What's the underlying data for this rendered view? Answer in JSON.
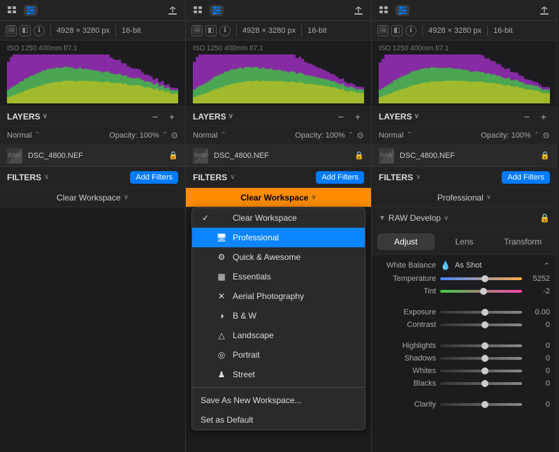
{
  "panels": [
    {
      "id": "panel1",
      "toolbar": {
        "icons": [
          "grid",
          "sliders",
          "upload"
        ]
      },
      "histogram": {
        "meta": "ISO 1250   400mm   f/7.1",
        "resolution": "4928 × 3280 px",
        "bitdepth": "16-bit"
      },
      "layers": {
        "title": "LAYERS",
        "opacity": "Opacity: 100%",
        "blend": "Normal",
        "items": [
          {
            "name": "DSC_4800.NEF"
          }
        ]
      },
      "filters": {
        "title": "FILTERS",
        "add_label": "Add Filters"
      },
      "workspace": {
        "label": "Clear Workspace",
        "active": false
      }
    },
    {
      "id": "panel2",
      "toolbar": {
        "icons": [
          "grid",
          "sliders",
          "upload"
        ]
      },
      "histogram": {
        "meta": "ISO 1250   400mm   f/7.1",
        "resolution": "4928 × 3280 px",
        "bitdepth": "16-bit"
      },
      "layers": {
        "title": "LAYERS",
        "opacity": "Opacity: 100%",
        "blend": "Normal",
        "items": [
          {
            "name": "DSC_4800.NEF"
          }
        ]
      },
      "filters": {
        "title": "FILTERS",
        "add_label": "Add Filters"
      },
      "workspace": {
        "label": "Clear Workspace",
        "active": true
      },
      "dropdown": {
        "items": [
          {
            "type": "check",
            "check": "✓",
            "icon": "",
            "label": "Clear Workspace",
            "selected": false
          },
          {
            "type": "item",
            "check": "",
            "icon": "🖥",
            "label": "Professional",
            "selected": true
          },
          {
            "type": "item",
            "check": "",
            "icon": "⚙",
            "label": "Quick & Awesome",
            "selected": false
          },
          {
            "type": "item",
            "check": "",
            "icon": "▦",
            "label": "Essentials",
            "selected": false
          },
          {
            "type": "item",
            "check": "",
            "icon": "✕",
            "label": "Aerial Photography",
            "selected": false
          },
          {
            "type": "item",
            "check": "",
            "icon": "◑",
            "label": "B & W",
            "selected": false
          },
          {
            "type": "item",
            "check": "",
            "icon": "△",
            "label": "Landscape",
            "selected": false
          },
          {
            "type": "item",
            "check": "",
            "icon": "◎",
            "label": "Portrait",
            "selected": false
          },
          {
            "type": "item",
            "check": "",
            "icon": "♟",
            "label": "Street",
            "selected": false
          }
        ],
        "actions": [
          "Save As New Workspace...",
          "Set as Default"
        ]
      }
    },
    {
      "id": "panel3",
      "toolbar": {
        "icons": [
          "grid",
          "sliders",
          "upload"
        ]
      },
      "histogram": {
        "meta": "ISO 1250   400mm   f/7.1",
        "resolution": "4928 × 3280 px",
        "bitdepth": "16-bit"
      },
      "layers": {
        "title": "LAYERS",
        "opacity": "Opacity: 100%",
        "blend": "Normal",
        "items": [
          {
            "name": "DSC_4800.NEF"
          }
        ]
      },
      "filters": {
        "title": "FILTERS",
        "add_label": "Add Filters"
      },
      "workspace": {
        "label": "Professional",
        "active": false
      },
      "raw": {
        "title": "RAW Develop",
        "tabs": [
          "Adjust",
          "Lens",
          "Transform"
        ],
        "active_tab": "Adjust",
        "white_balance": {
          "label": "White Balance",
          "value": "As Shot"
        },
        "sliders": [
          {
            "label": "Temperature",
            "value": "5252",
            "type": "temp",
            "pct": 52
          },
          {
            "label": "Tint",
            "value": "-2",
            "type": "tint",
            "pct": 49
          },
          {
            "label": "Exposure",
            "value": "0.00",
            "type": "exposure",
            "pct": 50
          },
          {
            "label": "Contrast",
            "value": "0",
            "type": "exposure",
            "pct": 50
          },
          {
            "label": "Highlights",
            "value": "0",
            "type": "exposure",
            "pct": 50
          },
          {
            "label": "Shadows",
            "value": "0",
            "type": "exposure",
            "pct": 50
          },
          {
            "label": "Whites",
            "value": "0",
            "type": "exposure",
            "pct": 50
          },
          {
            "label": "Blacks",
            "value": "0",
            "type": "exposure",
            "pct": 50
          },
          {
            "label": "Clarity",
            "value": "0",
            "type": "exposure",
            "pct": 50
          }
        ]
      }
    }
  ]
}
